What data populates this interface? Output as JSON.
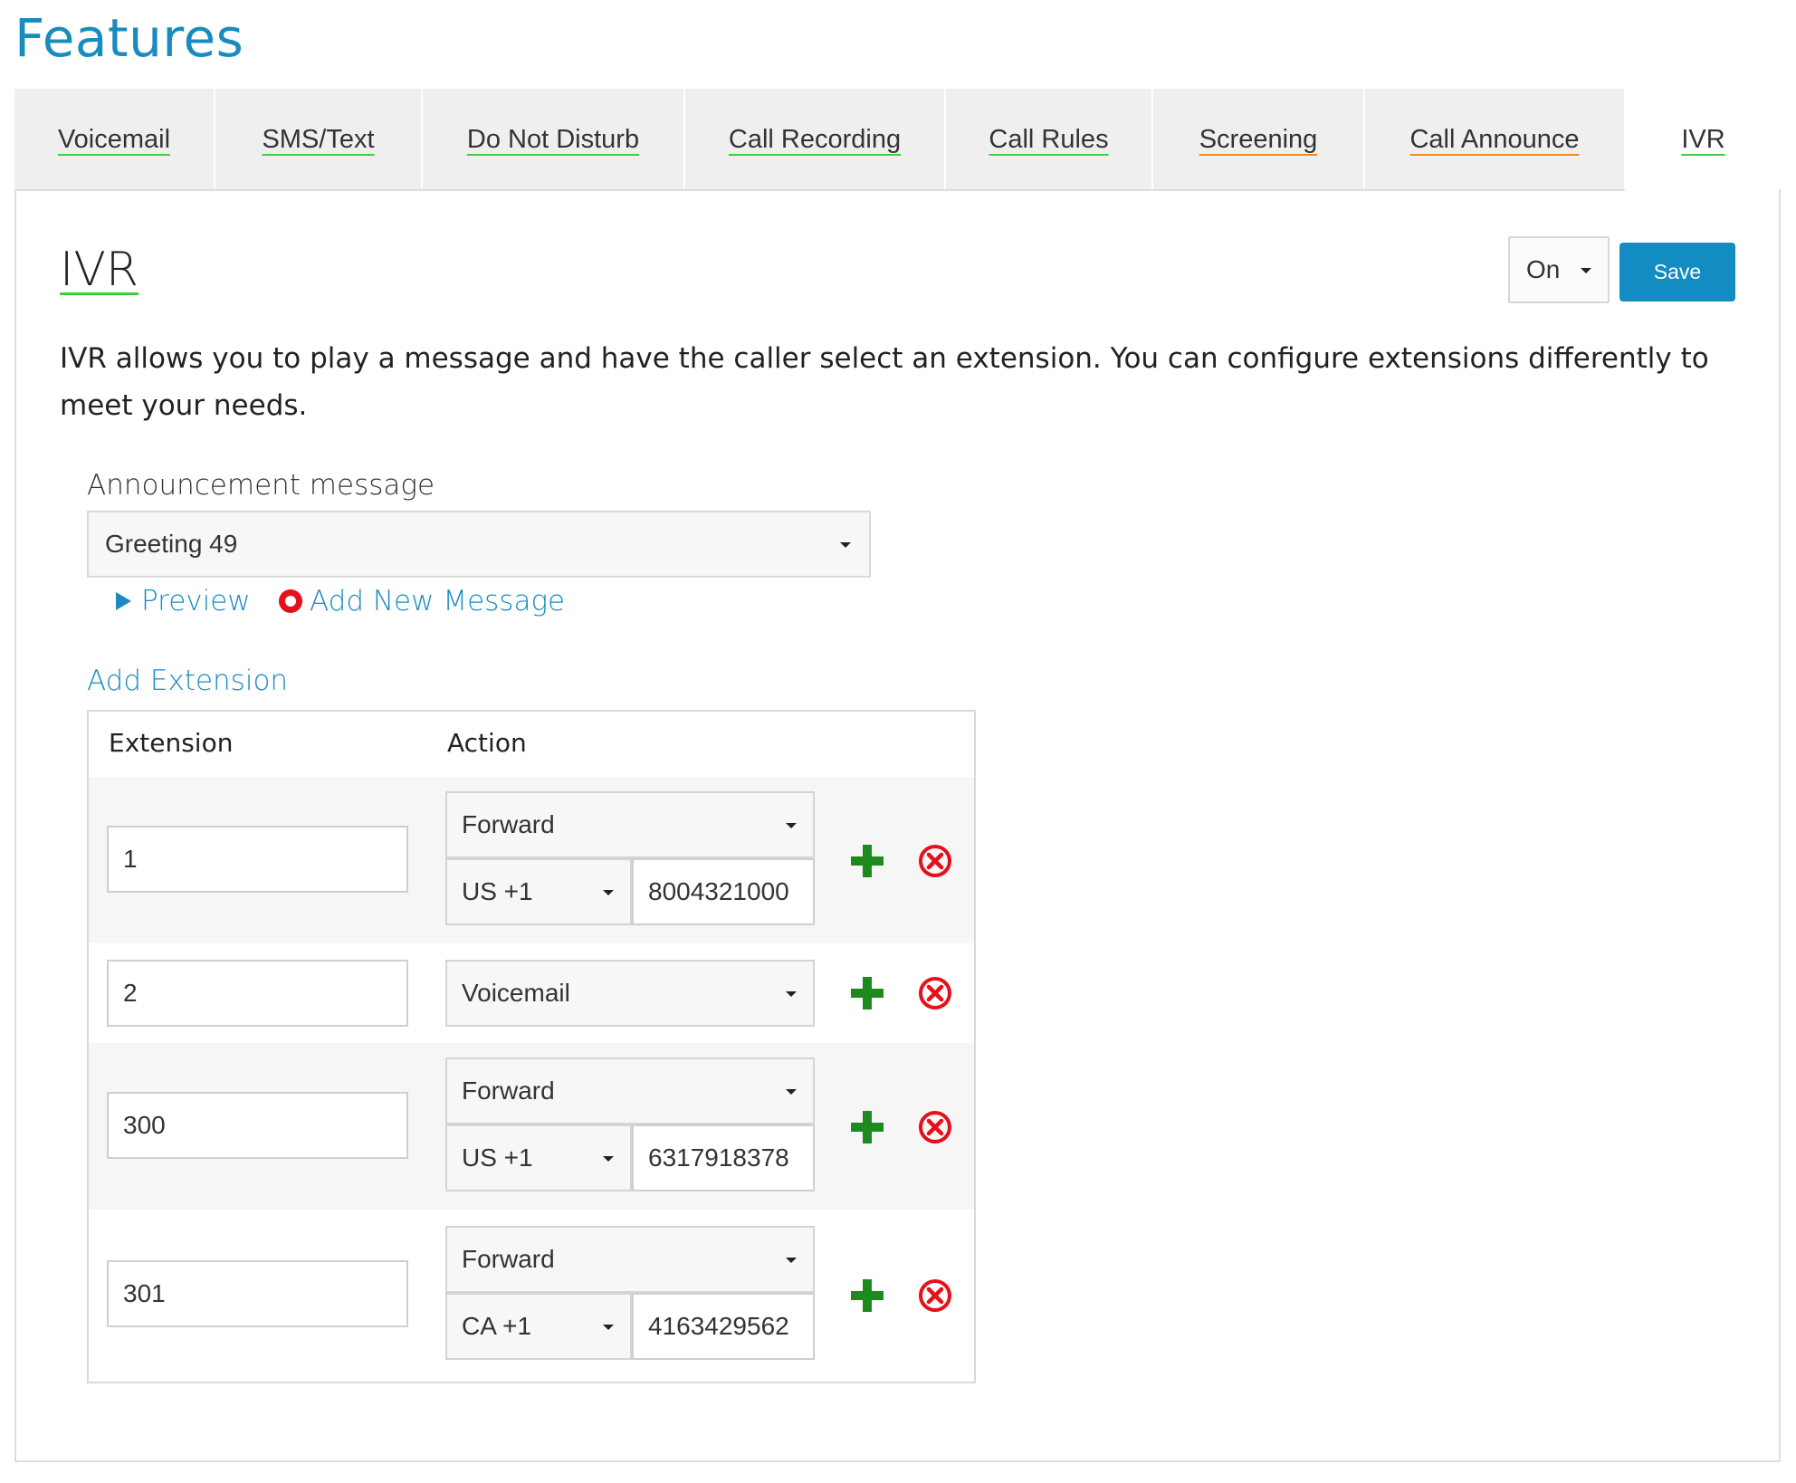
{
  "page": {
    "title": "Features"
  },
  "tabs": [
    {
      "label": "Voicemail",
      "underline": "#3ecf3e"
    },
    {
      "label": "SMS/Text",
      "underline": "#3ecf3e"
    },
    {
      "label": "Do Not Disturb",
      "underline": "#3ecf3e"
    },
    {
      "label": "Call Recording",
      "underline": "#3ecf3e"
    },
    {
      "label": "Call Rules",
      "underline": "#3ecf3e"
    },
    {
      "label": "Screening",
      "underline": "#f08a1c"
    },
    {
      "label": "Call Announce",
      "underline": "#f08a1c"
    },
    {
      "label": "IVR",
      "underline": "#3ecf3e",
      "active": true
    }
  ],
  "ivr": {
    "heading": "IVR",
    "state": "On",
    "save_label": "Save",
    "description": "IVR allows you to play a message and have the caller select an extension. You can configure extensions differently to meet your needs.",
    "announcement_label": "Announcement message",
    "announcement_value": "Greeting 49",
    "preview_label": "Preview",
    "add_message_label": "Add New Message",
    "add_extension_label": "Add Extension",
    "table": {
      "col_extension": "Extension",
      "col_action": "Action",
      "rows": [
        {
          "extension": "1",
          "action": "Forward",
          "country": "US +1",
          "number": "8004321000"
        },
        {
          "extension": "2",
          "action": "Voicemail"
        },
        {
          "extension": "300",
          "action": "Forward",
          "country": "US +1",
          "number": "6317918378"
        },
        {
          "extension": "301",
          "action": "Forward",
          "country": "CA +1",
          "number": "4163429562"
        }
      ]
    }
  },
  "colors": {
    "accent": "#1a8bbf",
    "save_button": "#138cc3",
    "add": "#1e8a1e",
    "delete": "#e4101a"
  },
  "icons": {
    "preview": "play-triangle-icon",
    "add_message": "record-icon",
    "add_row": "plus-icon",
    "delete_row": "delete-circle-x-icon"
  }
}
